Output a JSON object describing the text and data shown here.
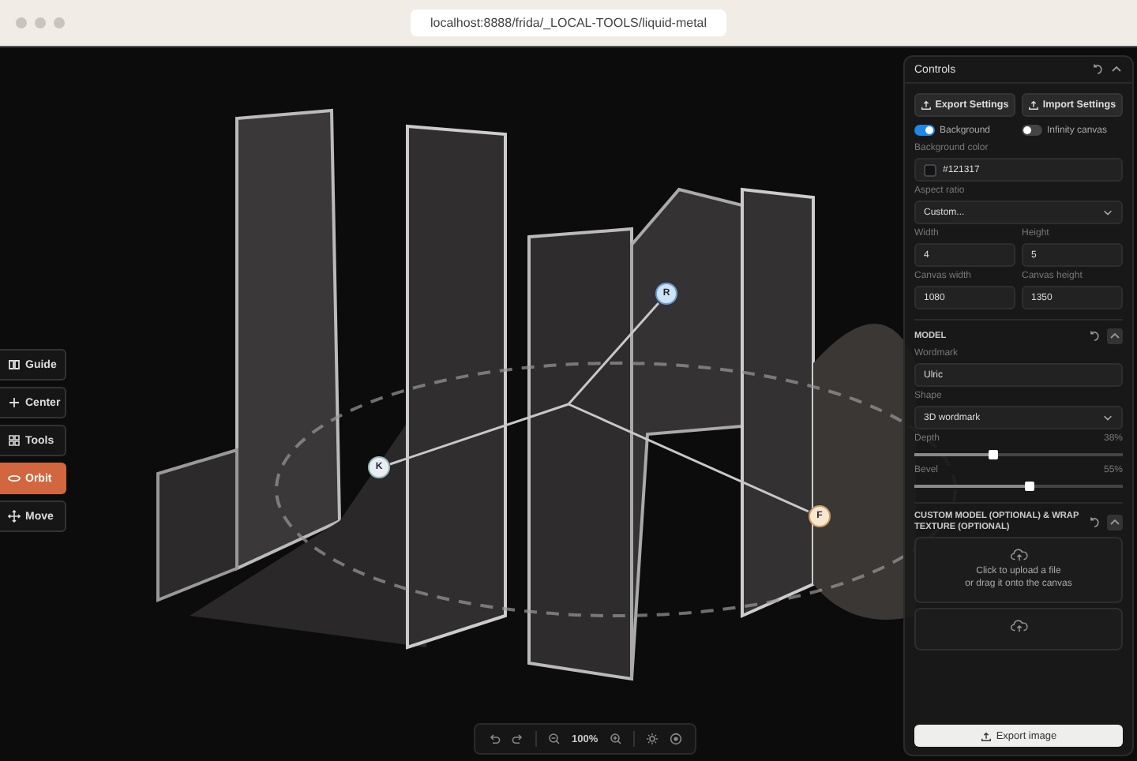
{
  "browser": {
    "url": "localhost:8888/frida/_LOCAL-TOOLS/liquid-metal"
  },
  "gizmo": {
    "nodes": [
      {
        "label": "R"
      },
      {
        "label": "K"
      },
      {
        "label": "F"
      }
    ]
  },
  "tools": [
    {
      "label": "Guide",
      "kind": "book",
      "selected": false
    },
    {
      "label": "Center",
      "kind": "plus",
      "selected": false
    },
    {
      "label": "Tools",
      "kind": "grid",
      "selected": false
    },
    {
      "label": "Orbit",
      "kind": "orbit",
      "selected": true
    },
    {
      "label": "Move",
      "kind": "move",
      "selected": false
    }
  ],
  "zoom_bar": {
    "zoom": "100%"
  },
  "controls": {
    "title": "Controls",
    "buttons": [
      "Export Settings",
      "Import Settings"
    ],
    "toggles": [
      {
        "label": "Background",
        "on": true
      },
      {
        "label": "Infinity canvas",
        "on": false
      }
    ],
    "background_color": {
      "label": "Background color",
      "value": "#121317"
    },
    "aspect_ratio": {
      "label": "Aspect ratio",
      "value": "Custom..."
    },
    "size_fields": [
      {
        "label": "Width",
        "value": "4"
      },
      {
        "label": "Height",
        "value": "5"
      },
      {
        "label": "Canvas width",
        "value": "1080"
      },
      {
        "label": "Canvas height",
        "value": "1350"
      }
    ],
    "model": {
      "title": "MODEL",
      "wordmark": {
        "label": "Wordmark",
        "value": "Ulric"
      },
      "shape": {
        "label": "Shape",
        "value": "3D wordmark"
      },
      "sliders": [
        {
          "label": "Depth",
          "reading": "38%",
          "level": 0.38
        },
        {
          "label": "Bevel",
          "reading": "55%",
          "level": 0.55
        }
      ]
    },
    "custom_model": {
      "title": "CUSTOM MODEL (OPTIONAL) & WRAP TEXTURE (OPTIONAL)",
      "upload_text": "Click to upload a file\nor drag it onto the canvas"
    },
    "export_button": "Export image"
  }
}
